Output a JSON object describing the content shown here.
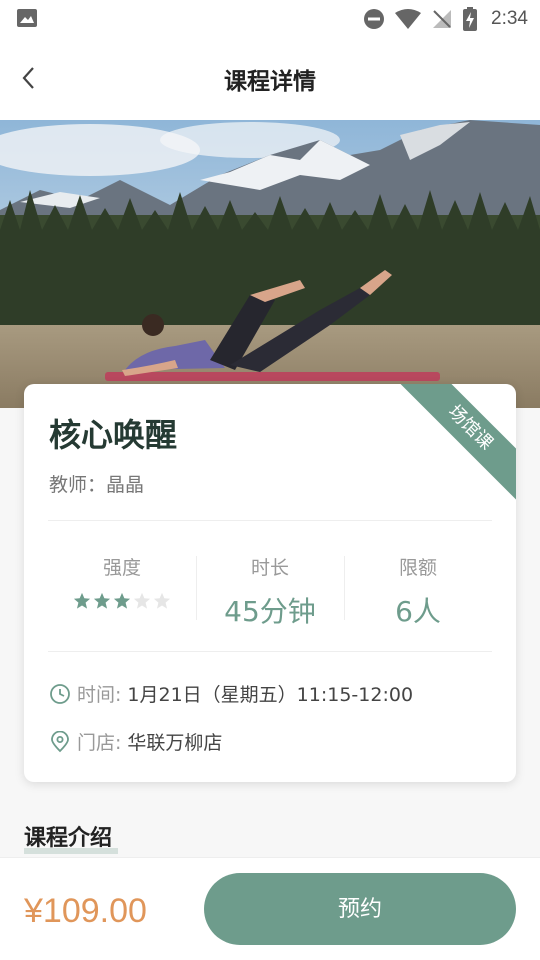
{
  "status_bar": {
    "time": "2:34"
  },
  "nav": {
    "title": "课程详情"
  },
  "course": {
    "name": "核心唤醒",
    "ribbon": "场馆课",
    "teacher_label": "教师：",
    "teacher": "晶晶",
    "stats": {
      "intensity_label": "强度",
      "intensity_value": 3,
      "intensity_max": 5,
      "duration_label": "时长",
      "duration_value": "45分钟",
      "quota_label": "限额",
      "quota_value": "6人"
    },
    "time_label": "时间:",
    "time_value": "1月21日（星期五）11:15-12:00",
    "store_label": "门店:",
    "store_value": "华联万柳店"
  },
  "section": {
    "intro_title": "课程介绍"
  },
  "footer": {
    "price": "¥109.00",
    "book_label": "预约"
  },
  "colors": {
    "accent": "#6e9c8c",
    "price": "#e0965a",
    "title": "#253a33"
  }
}
